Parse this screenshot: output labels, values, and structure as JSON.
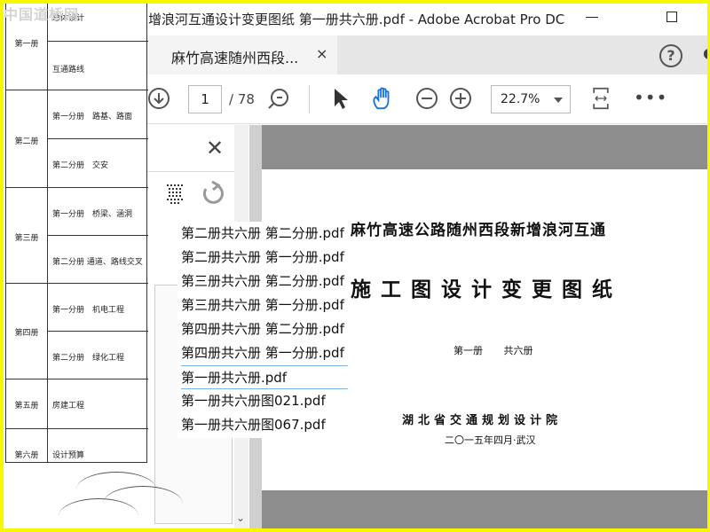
{
  "window": {
    "title": "增浪河互通设计变更图纸 第一册共六册.pdf - Adobe Acrobat Pro DC"
  },
  "tab": {
    "label": "麻竹高速随州西段...",
    "close": "×"
  },
  "toolbar": {
    "page_current": "1",
    "page_total": "/ 78",
    "zoom": "22.7%",
    "more": "•••"
  },
  "leftpane": {
    "close": "✕"
  },
  "document": {
    "title_line1": "麻竹高速公路随州西段新增浪河互通",
    "title_line2": "施工图设计变更图纸",
    "volume": "第一册 共六册",
    "organization": "湖北省交通规划设计院",
    "date": "二〇一五年四月·武汉"
  },
  "index_table": {
    "volumes": [
      {
        "label": "第一册",
        "subs": [
          "总体设计",
          "互通路线"
        ]
      },
      {
        "label": "第二册",
        "subs": [
          "第一分册　路基、路面",
          "第二分册　交安"
        ]
      },
      {
        "label": "第三册",
        "subs": [
          "第一分册　桥梁、涵洞",
          "第二分册 通道、路线交叉"
        ]
      },
      {
        "label": "第四册",
        "subs": [
          "第一分册　机电工程",
          "第二分册　绿化工程"
        ]
      },
      {
        "label": "第五册",
        "subs": [
          "房建工程"
        ]
      },
      {
        "label": "第六册",
        "subs": [
          "设计预算"
        ]
      }
    ]
  },
  "file_list": {
    "items": [
      "第二册共六册 第二分册.pdf",
      "第二册共六册 第一分册.pdf",
      "第三册共六册 第二分册.pdf",
      "第三册共六册 第一分册.pdf",
      "第四册共六册 第二分册.pdf",
      "第四册共六册 第一分册.pdf",
      "第一册共六册.pdf",
      "第一册共六册图021.pdf",
      "第一册共六册图067.pdf"
    ],
    "selected_index": 6
  },
  "watermark": "中国道桥网"
}
